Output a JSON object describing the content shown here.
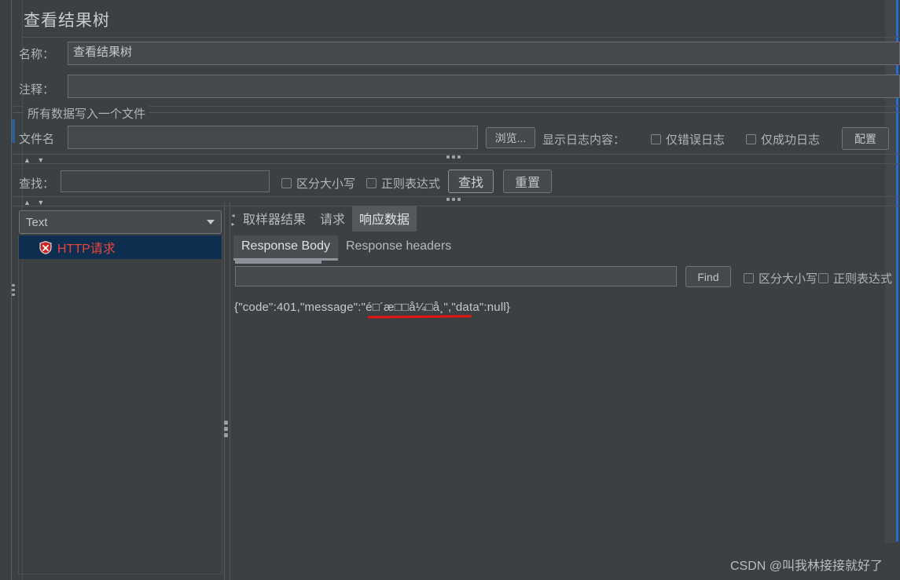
{
  "window": {
    "title": "查看结果树"
  },
  "form": {
    "name_label": "名称：",
    "name_value": "查看结果树",
    "comment_label": "注释：",
    "comment_value": "",
    "group_title": "所有数据写入一个文件",
    "filename_label": "文件名",
    "filename_value": "",
    "browse_button": "浏览...",
    "log_display_label": "显示日志内容：",
    "errors_only_checkbox": "仅错误日志",
    "success_only_checkbox": "仅成功日志",
    "configure_button": "配置"
  },
  "search_bar": {
    "label": "查找：",
    "value": "",
    "case_sensitive_checkbox": "区分大小写",
    "regex_checkbox": "正则表达式",
    "find_button": "查找",
    "reset_button": "重置"
  },
  "left_pane": {
    "renderer_select": "Text",
    "tree_items": [
      {
        "label": "HTTP请求",
        "icon": "error-shield-icon",
        "selected": true
      }
    ]
  },
  "right_pane": {
    "main_tabs": [
      {
        "label": "取样器结果",
        "selected": false
      },
      {
        "label": "请求",
        "selected": false
      },
      {
        "label": "响应数据",
        "selected": true
      }
    ],
    "sub_tabs": [
      {
        "label": "Response Body",
        "selected": true
      },
      {
        "label": "Response headers",
        "selected": false
      }
    ],
    "find": {
      "value": "",
      "button": "Find",
      "case_sensitive_checkbox": "区分大小写",
      "regex_checkbox": "正则表达式"
    },
    "response_body": "{\"code\":401,\"message\":\"é□´æ□□å¼□å¸\",\"data\":null}"
  },
  "watermark": "CSDN @叫我林接接就好了",
  "colors": {
    "background": "#3c4043",
    "field_background": "#45494d",
    "selection_blue": "#0d2e4e",
    "error_red": "#e8453c",
    "accent_blue": "#1f6fd0",
    "annotation_red": "#e8150f",
    "text": "#b6b9bd"
  }
}
